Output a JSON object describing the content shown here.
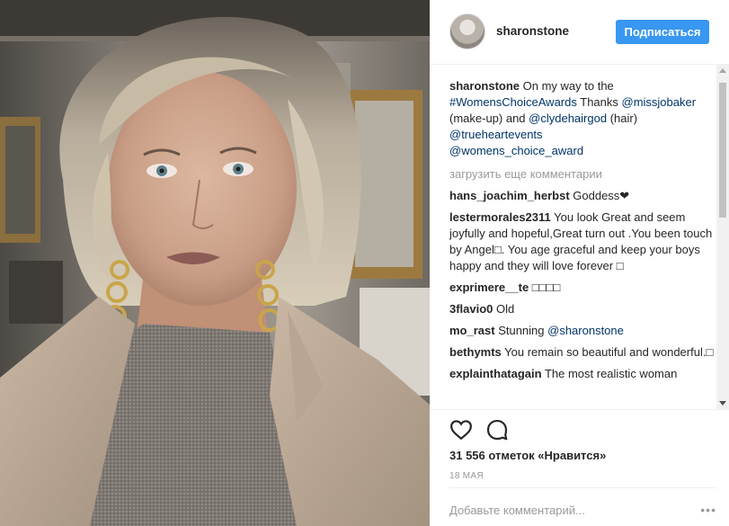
{
  "post": {
    "author": "sharonstone",
    "follow_label": "Подписаться",
    "caption": {
      "user": "sharonstone",
      "text_before": " On my way to the ",
      "hashtag": "#WomensChoiceAwards",
      "text_thanks": " Thanks ",
      "mention_makeup": "@missjobaker",
      "text_makeup": " (make-up) and ",
      "mention_hair": "@clydehairgod",
      "text_hair": " (hair) ",
      "mention_events": "@trueheartevents",
      "mention_award": "@womens_choice_award"
    },
    "load_more_label": "загрузить еще комментарии",
    "comments": [
      {
        "user": "hans_joachim_herbst",
        "text": " Goddess❤"
      },
      {
        "user": "lestermorales2311",
        "text": " You look Great and seem joyfully and hopeful,Great turn out .You been touch by Angel□. You age graceful and keep your boys happy and they will love forever □"
      },
      {
        "user": "exprimere__te",
        "text": " □□□□"
      },
      {
        "user": "3flavio0",
        "text": " Old"
      },
      {
        "user": "mo_rast",
        "text": " Stunning ",
        "mention": "@sharonstone"
      },
      {
        "user": "bethymts",
        "text": " You remain so beautiful and wonderful.□"
      },
      {
        "user": "explainthatagain",
        "text": " The most realistic woman"
      }
    ],
    "likes_text": "31 556 отметок «Нравится»",
    "date": "18 МАЯ",
    "add_comment_placeholder": "Добавьте комментарий...",
    "more_options": "•••"
  },
  "icons": {
    "like": "heart-outline-icon",
    "comment": "speech-bubble-icon"
  },
  "colors": {
    "follow_button": "#3897f0",
    "link": "#003569",
    "muted": "#999999"
  }
}
